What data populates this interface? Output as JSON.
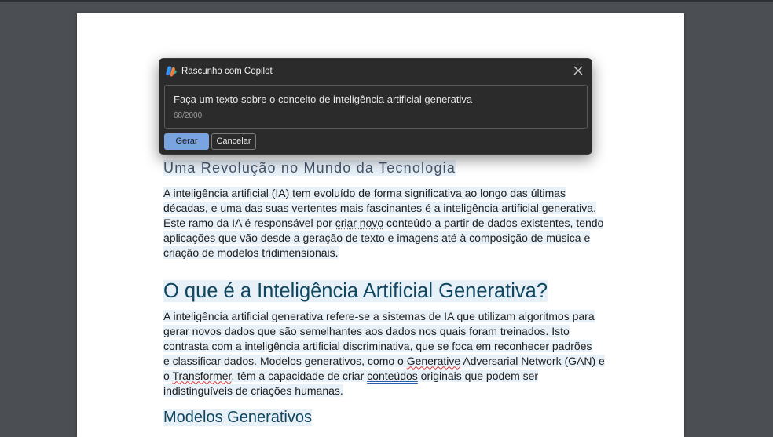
{
  "dialog": {
    "title": "Rascunho com Copilot",
    "prompt_value": "Faça um texto sobre o conceito de inteligência artificial generativa",
    "counter": "68/2000",
    "generate_label": "Gerar",
    "cancel_label": "Cancelar",
    "logo_icon": "copilot-icon",
    "close_icon": "close-icon"
  },
  "document": {
    "subtitle": "Uma Revolução no Mundo da Tecnologia",
    "para1": {
      "l1": "A inteligência artificial (IA) tem evoluído de forma significativa ao longo das últimas",
      "l2": "décadas, e uma das suas vertentes mais fascinantes é a inteligência artificial generativa.",
      "l3a": "Este ramo da IA é responsável por ",
      "l3b": "criar novo",
      "l3c": " conteúdo a partir de dados existentes, tendo",
      "l4": "aplicações que vão desde a geração de texto e imagens até à composição de música e",
      "l5": "criação de modelos tridimensionais."
    },
    "heading1": "O que é a Inteligência Artificial Generativa?",
    "para2": {
      "l1": "A inteligência artificial generativa refere-se a sistemas de IA que utilizam algoritmos para",
      "l2": "gerar novos dados que são semelhantes aos dados nos quais foram treinados. Isto",
      "l3": "contrasta com a inteligência artificial discriminativa, que se foca em reconhecer padrões",
      "l4a": "e classificar dados. Modelos generativos, como o ",
      "l4b": "Generative",
      "l4c": " Adversarial Network (GAN) e",
      "l5a": "o ",
      "l5b": "Transformer",
      "l5c": ", têm a capacidade de criar ",
      "l5d": "conteúdos",
      "l5e": " originais que podem ser",
      "l6": "indistinguíveis de criações humanas."
    },
    "heading2": "Modelos Generativos"
  },
  "colors": {
    "background": "#4b4e52",
    "dialog_bg": "#2b2b2b",
    "accent_button": "#7aa4e0",
    "heading": "#0f4761",
    "selection_highlight": "#e8f0f8"
  }
}
